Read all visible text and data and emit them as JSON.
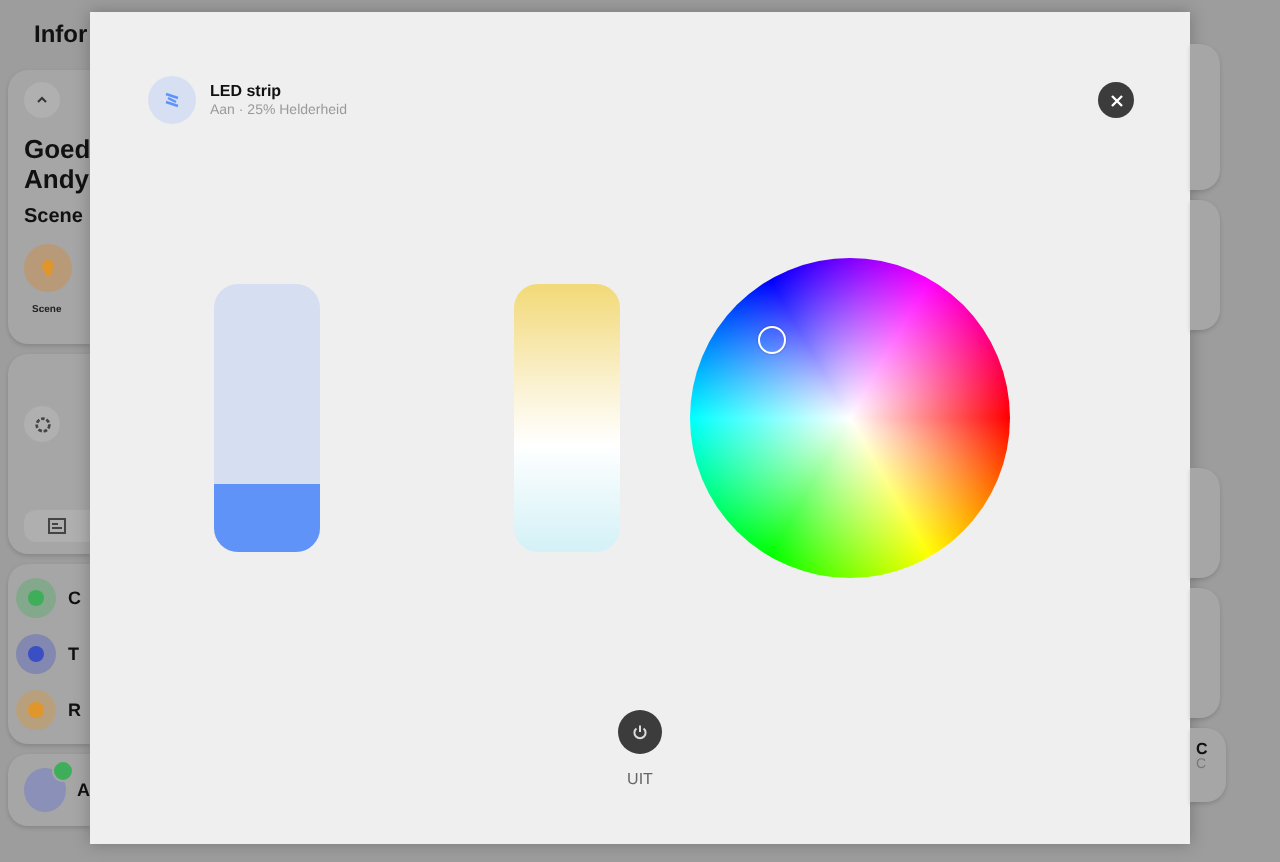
{
  "background": {
    "page_title": "Infor",
    "greeting": [
      "Goed",
      "Andy"
    ],
    "scenes_heading": "Scene",
    "scene_label": "Scene",
    "rows": [
      {
        "label": "C",
        "color": "#3fae5a"
      },
      {
        "label": "T",
        "color": "#3b4fc4"
      },
      {
        "label": "R",
        "color": "#e0962a"
      }
    ],
    "person": "A",
    "right_card": {
      "title": "C",
      "subtitle": "C"
    }
  },
  "dialog": {
    "title": "LED strip",
    "subtitle": "Aan · 25% Helderheid",
    "brightness": {
      "level": 0.25
    },
    "power": {
      "label": "UIT"
    }
  }
}
